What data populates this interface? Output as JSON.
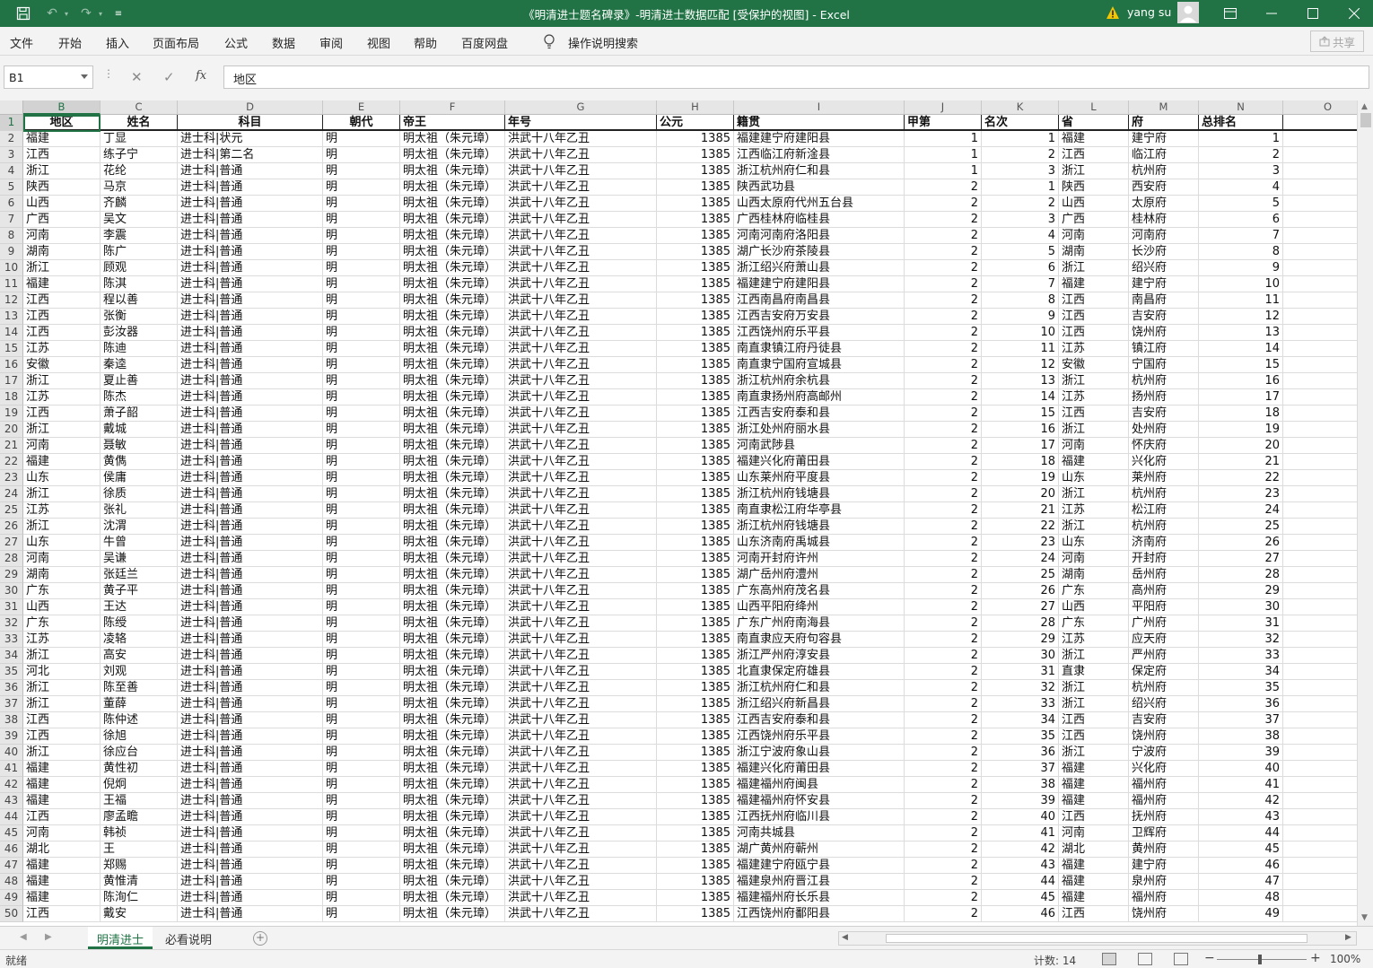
{
  "titlebar": {
    "title": "《明清进士题名碑录》-明清进士数据匹配  [受保护的视图]  -  Excel",
    "user": "yang su"
  },
  "ribbon": {
    "tabs": [
      "文件",
      "开始",
      "插入",
      "页面布局",
      "公式",
      "数据",
      "审阅",
      "视图",
      "帮助",
      "百度网盘"
    ],
    "tell_me": "操作说明搜索",
    "share": "共享"
  },
  "formula_bar": {
    "name_box": "B1",
    "fx": "fx",
    "content": "地区"
  },
  "sheet": {
    "columns": [
      "B",
      "C",
      "D",
      "E",
      "F",
      "G",
      "H",
      "I",
      "J",
      "K",
      "L",
      "M",
      "N",
      "O"
    ],
    "selected_column": "B",
    "header_row": [
      "地区",
      "姓名",
      "科目",
      "朝代",
      "帝王",
      "年号",
      "公元",
      "籍贯",
      "甲第",
      "名次",
      "省",
      "府",
      "总排名",
      ""
    ],
    "rows": [
      [
        "福建",
        "丁显",
        "进士科|状元",
        "明",
        "明太祖（朱元璋）",
        "洪武十八年乙丑",
        "1385",
        "福建建宁府建阳县",
        "1",
        "1",
        "福建",
        "建宁府",
        "1"
      ],
      [
        "江西",
        "练子宁",
        "进士科|第二名",
        "明",
        "明太祖（朱元璋）",
        "洪武十八年乙丑",
        "1385",
        "江西临江府新淦县",
        "1",
        "2",
        "江西",
        "临江府",
        "2"
      ],
      [
        "浙江",
        "花纶",
        "进士科|普通",
        "明",
        "明太祖（朱元璋）",
        "洪武十八年乙丑",
        "1385",
        "浙江杭州府仁和县",
        "1",
        "3",
        "浙江",
        "杭州府",
        "3"
      ],
      [
        "陕西",
        "马京",
        "进士科|普通",
        "明",
        "明太祖（朱元璋）",
        "洪武十八年乙丑",
        "1385",
        "陕西武功县",
        "2",
        "1",
        "陕西",
        "西安府",
        "4"
      ],
      [
        "山西",
        "齐麟",
        "进士科|普通",
        "明",
        "明太祖（朱元璋）",
        "洪武十八年乙丑",
        "1385",
        "山西太原府代州五台县",
        "2",
        "2",
        "山西",
        "太原府",
        "5"
      ],
      [
        "广西",
        "吴文",
        "进士科|普通",
        "明",
        "明太祖（朱元璋）",
        "洪武十八年乙丑",
        "1385",
        "广西桂林府临桂县",
        "2",
        "3",
        "广西",
        "桂林府",
        "6"
      ],
      [
        "河南",
        "李震",
        "进士科|普通",
        "明",
        "明太祖（朱元璋）",
        "洪武十八年乙丑",
        "1385",
        "河南河南府洛阳县",
        "2",
        "4",
        "河南",
        "河南府",
        "7"
      ],
      [
        "湖南",
        "陈广",
        "进士科|普通",
        "明",
        "明太祖（朱元璋）",
        "洪武十八年乙丑",
        "1385",
        "湖广长沙府茶陵县",
        "2",
        "5",
        "湖南",
        "长沙府",
        "8"
      ],
      [
        "浙江",
        "顾观",
        "进士科|普通",
        "明",
        "明太祖（朱元璋）",
        "洪武十八年乙丑",
        "1385",
        "浙江绍兴府萧山县",
        "2",
        "6",
        "浙江",
        "绍兴府",
        "9"
      ],
      [
        "福建",
        "陈淇",
        "进士科|普通",
        "明",
        "明太祖（朱元璋）",
        "洪武十八年乙丑",
        "1385",
        "福建建宁府建阳县",
        "2",
        "7",
        "福建",
        "建宁府",
        "10"
      ],
      [
        "江西",
        "程以善",
        "进士科|普通",
        "明",
        "明太祖（朱元璋）",
        "洪武十八年乙丑",
        "1385",
        "江西南昌府南昌县",
        "2",
        "8",
        "江西",
        "南昌府",
        "11"
      ],
      [
        "江西",
        "张衡",
        "进士科|普通",
        "明",
        "明太祖（朱元璋）",
        "洪武十八年乙丑",
        "1385",
        "江西吉安府万安县",
        "2",
        "9",
        "江西",
        "吉安府",
        "12"
      ],
      [
        "江西",
        "彭汝器",
        "进士科|普通",
        "明",
        "明太祖（朱元璋）",
        "洪武十八年乙丑",
        "1385",
        "江西饶州府乐平县",
        "2",
        "10",
        "江西",
        "饶州府",
        "13"
      ],
      [
        "江苏",
        "陈迪",
        "进士科|普通",
        "明",
        "明太祖（朱元璋）",
        "洪武十八年乙丑",
        "1385",
        "南直隶镇江府丹徒县",
        "2",
        "11",
        "江苏",
        "镇江府",
        "14"
      ],
      [
        "安徽",
        "秦逵",
        "进士科|普通",
        "明",
        "明太祖（朱元璋）",
        "洪武十八年乙丑",
        "1385",
        "南直隶宁国府宣城县",
        "2",
        "12",
        "安徽",
        "宁国府",
        "15"
      ],
      [
        "浙江",
        "夏止善",
        "进士科|普通",
        "明",
        "明太祖（朱元璋）",
        "洪武十八年乙丑",
        "1385",
        "浙江杭州府余杭县",
        "2",
        "13",
        "浙江",
        "杭州府",
        "16"
      ],
      [
        "江苏",
        "陈杰",
        "进士科|普通",
        "明",
        "明太祖（朱元璋）",
        "洪武十八年乙丑",
        "1385",
        "南直隶扬州府高邮州",
        "2",
        "14",
        "江苏",
        "扬州府",
        "17"
      ],
      [
        "江西",
        "萧子韶",
        "进士科|普通",
        "明",
        "明太祖（朱元璋）",
        "洪武十八年乙丑",
        "1385",
        "江西吉安府泰和县",
        "2",
        "15",
        "江西",
        "吉安府",
        "18"
      ],
      [
        "浙江",
        "戴城",
        "进士科|普通",
        "明",
        "明太祖（朱元璋）",
        "洪武十八年乙丑",
        "1385",
        "浙江处州府丽水县",
        "2",
        "16",
        "浙江",
        "处州府",
        "19"
      ],
      [
        "河南",
        "聂敏",
        "进士科|普通",
        "明",
        "明太祖（朱元璋）",
        "洪武十八年乙丑",
        "1385",
        "河南武陟县",
        "2",
        "17",
        "河南",
        "怀庆府",
        "20"
      ],
      [
        "福建",
        "黄儁",
        "进士科|普通",
        "明",
        "明太祖（朱元璋）",
        "洪武十八年乙丑",
        "1385",
        "福建兴化府莆田县",
        "2",
        "18",
        "福建",
        "兴化府",
        "21"
      ],
      [
        "山东",
        "侯庸",
        "进士科|普通",
        "明",
        "明太祖（朱元璋）",
        "洪武十八年乙丑",
        "1385",
        "山东莱州府平度县",
        "2",
        "19",
        "山东",
        "莱州府",
        "22"
      ],
      [
        "浙江",
        "徐质",
        "进士科|普通",
        "明",
        "明太祖（朱元璋）",
        "洪武十八年乙丑",
        "1385",
        "浙江杭州府钱塘县",
        "2",
        "20",
        "浙江",
        "杭州府",
        "23"
      ],
      [
        "江苏",
        "张礼",
        "进士科|普通",
        "明",
        "明太祖（朱元璋）",
        "洪武十八年乙丑",
        "1385",
        "南直隶松江府华亭县",
        "2",
        "21",
        "江苏",
        "松江府",
        "24"
      ],
      [
        "浙江",
        "沈渭",
        "进士科|普通",
        "明",
        "明太祖（朱元璋）",
        "洪武十八年乙丑",
        "1385",
        "浙江杭州府钱塘县",
        "2",
        "22",
        "浙江",
        "杭州府",
        "25"
      ],
      [
        "山东",
        "牛曾",
        "进士科|普通",
        "明",
        "明太祖（朱元璋）",
        "洪武十八年乙丑",
        "1385",
        "山东济南府禹城县",
        "2",
        "23",
        "山东",
        "济南府",
        "26"
      ],
      [
        "河南",
        "吴谦",
        "进士科|普通",
        "明",
        "明太祖（朱元璋）",
        "洪武十八年乙丑",
        "1385",
        "河南开封府许州",
        "2",
        "24",
        "河南",
        "开封府",
        "27"
      ],
      [
        "湖南",
        "张廷兰",
        "进士科|普通",
        "明",
        "明太祖（朱元璋）",
        "洪武十八年乙丑",
        "1385",
        "湖广岳州府澧州",
        "2",
        "25",
        "湖南",
        "岳州府",
        "28"
      ],
      [
        "广东",
        "黄子平",
        "进士科|普通",
        "明",
        "明太祖（朱元璋）",
        "洪武十八年乙丑",
        "1385",
        "广东高州府茂名县",
        "2",
        "26",
        "广东",
        "高州府",
        "29"
      ],
      [
        "山西",
        "王达",
        "进士科|普通",
        "明",
        "明太祖（朱元璋）",
        "洪武十八年乙丑",
        "1385",
        "山西平阳府绛州",
        "2",
        "27",
        "山西",
        "平阳府",
        "30"
      ],
      [
        "广东",
        "陈绶",
        "进士科|普通",
        "明",
        "明太祖（朱元璋）",
        "洪武十八年乙丑",
        "1385",
        "广东广州府南海县",
        "2",
        "28",
        "广东",
        "广州府",
        "31"
      ],
      [
        "江苏",
        "凌辂",
        "进士科|普通",
        "明",
        "明太祖（朱元璋）",
        "洪武十八年乙丑",
        "1385",
        "南直隶应天府句容县",
        "2",
        "29",
        "江苏",
        "应天府",
        "32"
      ],
      [
        "浙江",
        "高安",
        "进士科|普通",
        "明",
        "明太祖（朱元璋）",
        "洪武十八年乙丑",
        "1385",
        "浙江严州府淳安县",
        "2",
        "30",
        "浙江",
        "严州府",
        "33"
      ],
      [
        "河北",
        "刘观",
        "进士科|普通",
        "明",
        "明太祖（朱元璋）",
        "洪武十八年乙丑",
        "1385",
        "北直隶保定府雄县",
        "2",
        "31",
        "直隶",
        "保定府",
        "34"
      ],
      [
        "浙江",
        "陈至善",
        "进士科|普通",
        "明",
        "明太祖（朱元璋）",
        "洪武十八年乙丑",
        "1385",
        "浙江杭州府仁和县",
        "2",
        "32",
        "浙江",
        "杭州府",
        "35"
      ],
      [
        "浙江",
        "董薛",
        "进士科|普通",
        "明",
        "明太祖（朱元璋）",
        "洪武十八年乙丑",
        "1385",
        "浙江绍兴府新昌县",
        "2",
        "33",
        "浙江",
        "绍兴府",
        "36"
      ],
      [
        "江西",
        "陈仲述",
        "进士科|普通",
        "明",
        "明太祖（朱元璋）",
        "洪武十八年乙丑",
        "1385",
        "江西吉安府泰和县",
        "2",
        "34",
        "江西",
        "吉安府",
        "37"
      ],
      [
        "江西",
        "徐旭",
        "进士科|普通",
        "明",
        "明太祖（朱元璋）",
        "洪武十八年乙丑",
        "1385",
        "江西饶州府乐平县",
        "2",
        "35",
        "江西",
        "饶州府",
        "38"
      ],
      [
        "浙江",
        "徐应台",
        "进士科|普通",
        "明",
        "明太祖（朱元璋）",
        "洪武十八年乙丑",
        "1385",
        "浙江宁波府象山县",
        "2",
        "36",
        "浙江",
        "宁波府",
        "39"
      ],
      [
        "福建",
        "黄性初",
        "进士科|普通",
        "明",
        "明太祖（朱元璋）",
        "洪武十八年乙丑",
        "1385",
        "福建兴化府莆田县",
        "2",
        "37",
        "福建",
        "兴化府",
        "40"
      ],
      [
        "福建",
        "倪炯",
        "进士科|普通",
        "明",
        "明太祖（朱元璋）",
        "洪武十八年乙丑",
        "1385",
        "福建福州府闽县",
        "2",
        "38",
        "福建",
        "福州府",
        "41"
      ],
      [
        "福建",
        "王福",
        "进士科|普通",
        "明",
        "明太祖（朱元璋）",
        "洪武十八年乙丑",
        "1385",
        "福建福州府怀安县",
        "2",
        "39",
        "福建",
        "福州府",
        "42"
      ],
      [
        "江西",
        "廖孟瞻",
        "进士科|普通",
        "明",
        "明太祖（朱元璋）",
        "洪武十八年乙丑",
        "1385",
        "江西抚州府临川县",
        "2",
        "40",
        "江西",
        "抚州府",
        "43"
      ],
      [
        "河南",
        "韩祯",
        "进士科|普通",
        "明",
        "明太祖（朱元璋）",
        "洪武十八年乙丑",
        "1385",
        "河南共城县",
        "2",
        "41",
        "河南",
        "卫辉府",
        "44"
      ],
      [
        "湖北",
        "王",
        "进士科|普通",
        "明",
        "明太祖（朱元璋）",
        "洪武十八年乙丑",
        "1385",
        "湖广黄州府蕲州",
        "2",
        "42",
        "湖北",
        "黄州府",
        "45"
      ],
      [
        "福建",
        "郑赐",
        "进士科|普通",
        "明",
        "明太祖（朱元璋）",
        "洪武十八年乙丑",
        "1385",
        "福建建宁府瓯宁县",
        "2",
        "43",
        "福建",
        "建宁府",
        "46"
      ],
      [
        "福建",
        "黄惟清",
        "进士科|普通",
        "明",
        "明太祖（朱元璋）",
        "洪武十八年乙丑",
        "1385",
        "福建泉州府晋江县",
        "2",
        "44",
        "福建",
        "泉州府",
        "47"
      ],
      [
        "福建",
        "陈洵仁",
        "进士科|普通",
        "明",
        "明太祖（朱元璋）",
        "洪武十八年乙丑",
        "1385",
        "福建福州府长乐县",
        "2",
        "45",
        "福建",
        "福州府",
        "48"
      ],
      [
        "江西",
        "戴安",
        "进士科|普通",
        "明",
        "明太祖（朱元璋）",
        "洪武十八年乙丑",
        "1385",
        "江西饶州府鄱阳县",
        "2",
        "46",
        "江西",
        "饶州府",
        "49"
      ]
    ]
  },
  "sheet_tabs": [
    "明清进士",
    "必看说明"
  ],
  "status": {
    "ready": "就绪",
    "count": "计数: 14",
    "zoom": "100%"
  },
  "colors": {
    "excel_green": "#217346"
  }
}
